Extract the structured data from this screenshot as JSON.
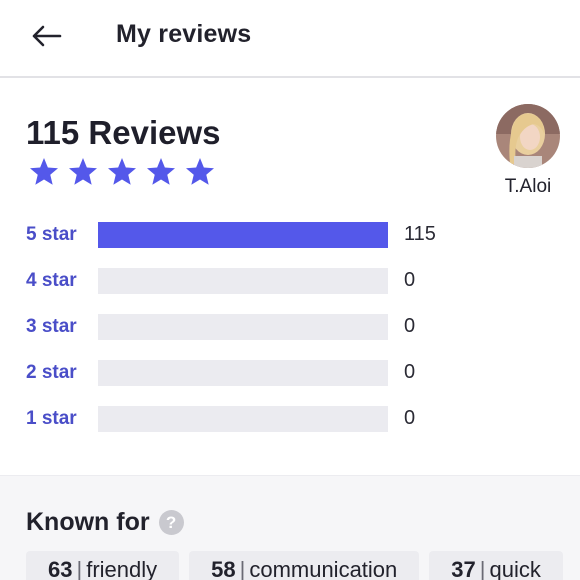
{
  "header": {
    "title": "My reviews"
  },
  "summary": {
    "count_label": "115 Reviews",
    "rating_stars": 5,
    "star_color": "#5458ea"
  },
  "reviewer": {
    "name": "T.Aloi"
  },
  "breakdown": [
    {
      "label": "5 star",
      "count": "115",
      "fraction": 1.0
    },
    {
      "label": "4 star",
      "count": "0",
      "fraction": 0
    },
    {
      "label": "3 star",
      "count": "0",
      "fraction": 0
    },
    {
      "label": "2 star",
      "count": "0",
      "fraction": 0
    },
    {
      "label": "1 star",
      "count": "0",
      "fraction": 0
    }
  ],
  "known_for": {
    "title": "Known for",
    "help_icon": "?",
    "tags": [
      {
        "count": "63",
        "label": "friendly"
      },
      {
        "count": "58",
        "label": "communication"
      },
      {
        "count": "37",
        "label": "quick"
      }
    ]
  },
  "colors": {
    "accent": "#5458ea",
    "label_accent": "#4a4ec8",
    "track": "#ebebf0"
  }
}
